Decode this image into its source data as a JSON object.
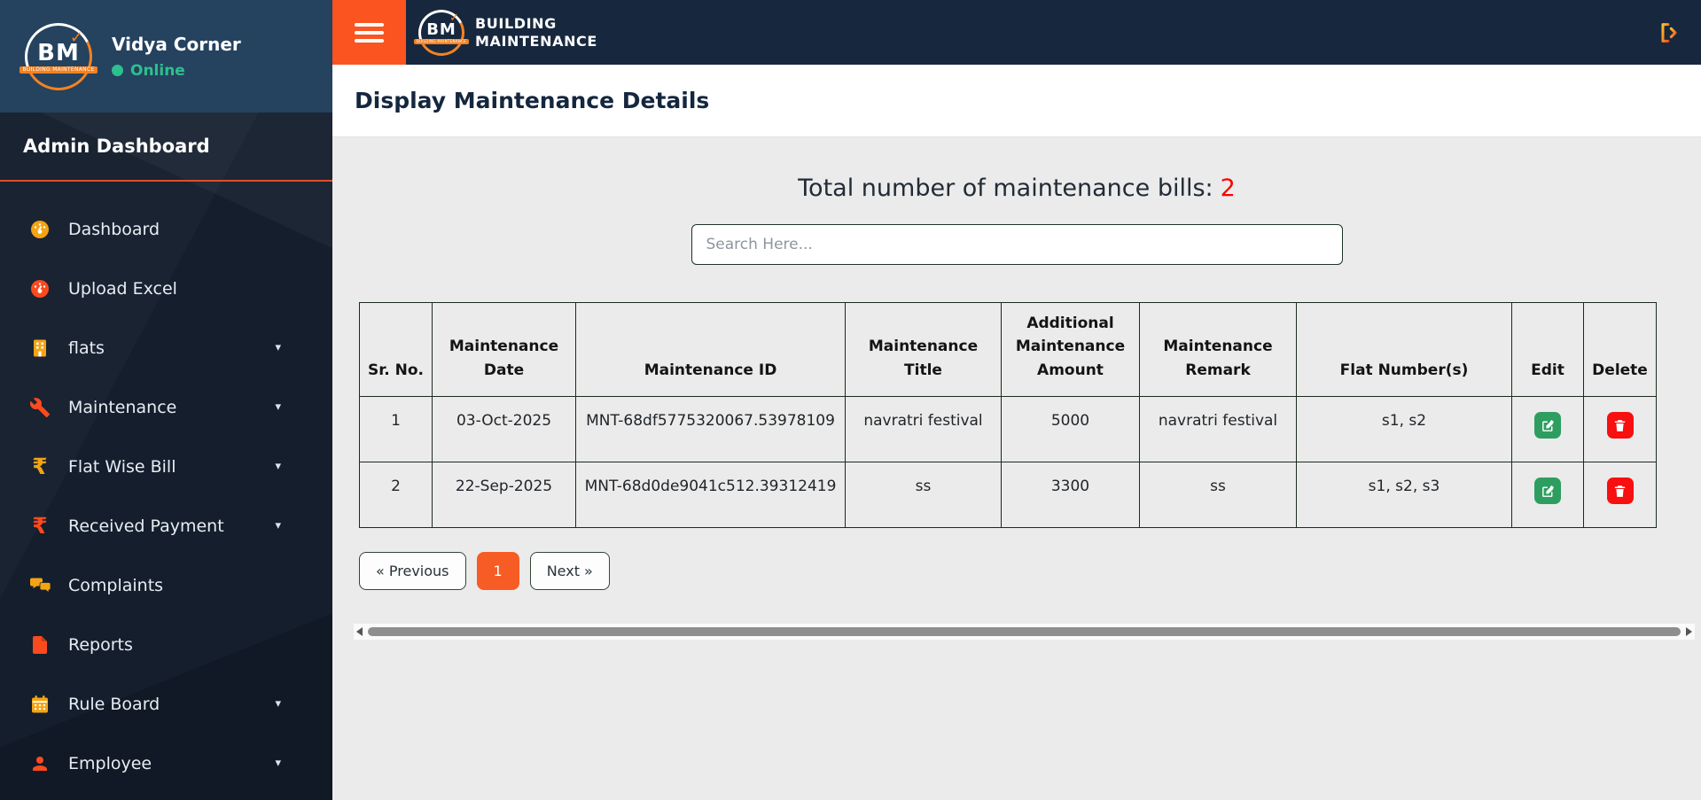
{
  "sidebar": {
    "logo": {
      "initials": "BM",
      "banner": "BUILDING MAINTENANCE",
      "check": "✓"
    },
    "society_name": "Vidya Corner",
    "status": "Online",
    "section_title": "Admin Dashboard",
    "items": [
      {
        "label": "Dashboard",
        "icon": "gauge-icon",
        "color": "#f4a413",
        "has_submenu": false
      },
      {
        "label": "Upload Excel",
        "icon": "gauge-icon",
        "color": "#fb4a1e",
        "has_submenu": false
      },
      {
        "label": "flats",
        "icon": "building-icon",
        "color": "#f4a413",
        "has_submenu": true
      },
      {
        "label": "Maintenance",
        "icon": "wrench-icon",
        "color": "#fb4a1e",
        "has_submenu": true
      },
      {
        "label": "Flat Wise Bill",
        "icon": "rupee-icon",
        "color": "#f4a413",
        "has_submenu": true
      },
      {
        "label": "Received Payment",
        "icon": "rupee-icon",
        "color": "#fb4a1e",
        "has_submenu": true
      },
      {
        "label": "Complaints",
        "icon": "chat-icon",
        "color": "#f4a413",
        "has_submenu": false
      },
      {
        "label": "Reports",
        "icon": "file-icon",
        "color": "#fb4a1e",
        "has_submenu": false
      },
      {
        "label": "Rule Board",
        "icon": "calendar-icon",
        "color": "#f4a413",
        "has_submenu": true
      },
      {
        "label": "Employee",
        "icon": "person-icon",
        "color": "#fb4a1e",
        "has_submenu": true
      }
    ],
    "caret": "▾",
    "rupee": "₹"
  },
  "navbar": {
    "brand_line1": "BUILDING",
    "brand_line2": "MAINTENANCE"
  },
  "page": {
    "title": "Display Maintenance Details"
  },
  "main": {
    "total_label": "Total number of maintenance bills:",
    "total_count": "2",
    "search_placeholder": "Search Here...",
    "table": {
      "headers": [
        "Sr. No.",
        "Maintenance Date",
        "Maintenance ID",
        "Maintenance Title",
        "Additional Maintenance Amount",
        "Maintenance Remark",
        "Flat Number(s)",
        "Edit",
        "Delete"
      ],
      "rows": [
        {
          "sr": "1",
          "date": "03-Oct-2025",
          "id": "MNT-68df5775320067.53978109",
          "title": "navratri festival",
          "amount": "5000",
          "remark": "navratri festival",
          "flats": "s1, s2"
        },
        {
          "sr": "2",
          "date": "22-Sep-2025",
          "id": "MNT-68d0de9041c512.39312419",
          "title": "ss",
          "amount": "3300",
          "remark": "ss",
          "flats": "s1, s2, s3"
        }
      ]
    },
    "pagination": {
      "previous": "« Previous",
      "current": "1",
      "next": "Next »"
    }
  },
  "colors": {
    "accent_orange": "#fb5420",
    "icon_yellow": "#f4a413",
    "icon_orange": "#fb4a1e",
    "success_green": "#2e9e60",
    "danger_red": "#f80f0f",
    "count_red": "#ff0000",
    "online_green": "#2dc08d",
    "sidebar_navy": "#141e2d",
    "user_panel_blue": "#25425f",
    "navbar_navy": "#17283e"
  }
}
